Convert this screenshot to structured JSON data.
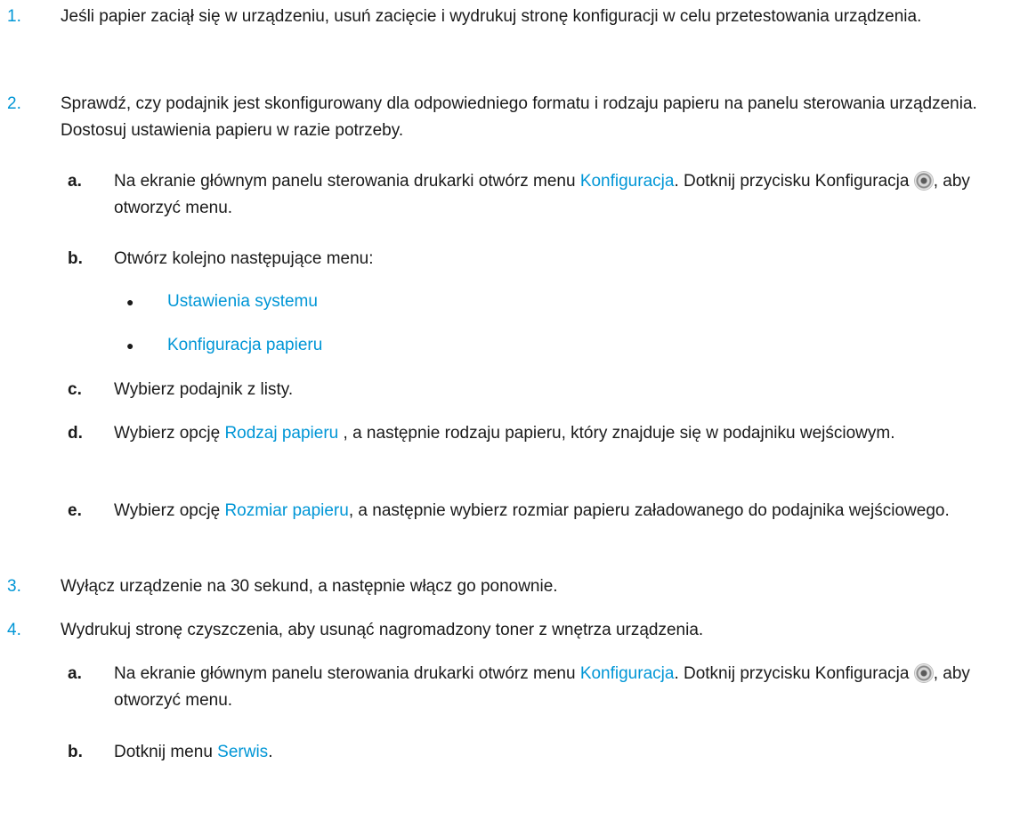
{
  "steps": [
    {
      "num": "1.",
      "text": "Jeśli papier zaciął się w urządzeniu, usuń zacięcie i wydrukuj stronę konfiguracji w celu przetestowania urządzenia."
    },
    {
      "num": "2.",
      "text": "Sprawdź, czy podajnik jest skonfigurowany dla odpowiedniego formatu i rodzaju papieru na panelu sterowania urządzenia. Dostosuj ustawienia papieru w razie potrzeby."
    },
    {
      "num": "3.",
      "text": "Wyłącz urządzenie na 30 sekund, a następnie włącz go ponownie."
    },
    {
      "num": "4.",
      "text": "Wydrukuj stronę czyszczenia, aby usunąć nagromadzony toner z wnętrza urządzenia."
    }
  ],
  "step2": {
    "a": {
      "label": "a.",
      "pre": "Na ekranie głównym panelu sterowania drukarki otwórz menu ",
      "link": "Konfiguracja",
      "mid": ". Dotknij przycisku Konfiguracja ",
      "post": ", aby otworzyć menu."
    },
    "b": {
      "label": "b.",
      "text": "Otwórz kolejno następujące menu:"
    },
    "bullets": [
      "Ustawienia systemu",
      "Konfiguracja papieru"
    ],
    "c": {
      "label": "c.",
      "text": "Wybierz podajnik z listy."
    },
    "d": {
      "label": "d.",
      "pre": "Wybierz opcję ",
      "link": "Rodzaj papieru ",
      "post": ", a następnie rodzaju papieru, który znajduje się w podajniku wejściowym."
    },
    "e": {
      "label": "e.",
      "pre": "Wybierz opcję ",
      "link": "Rozmiar papieru",
      "post": ", a następnie wybierz rozmiar papieru załadowanego do podajnika wejściowego."
    }
  },
  "step4": {
    "a": {
      "label": "a.",
      "pre": "Na ekranie głównym panelu sterowania drukarki otwórz menu ",
      "link": "Konfiguracja",
      "mid": ". Dotknij przycisku Konfiguracja ",
      "post": ", aby otworzyć menu."
    },
    "b": {
      "label": "b.",
      "pre": "Dotknij menu ",
      "link": "Serwis",
      "post": "."
    }
  },
  "icons": {
    "settings": "gear-icon"
  },
  "colors": {
    "accent": "#0096d6",
    "text": "#1a1a1a"
  }
}
